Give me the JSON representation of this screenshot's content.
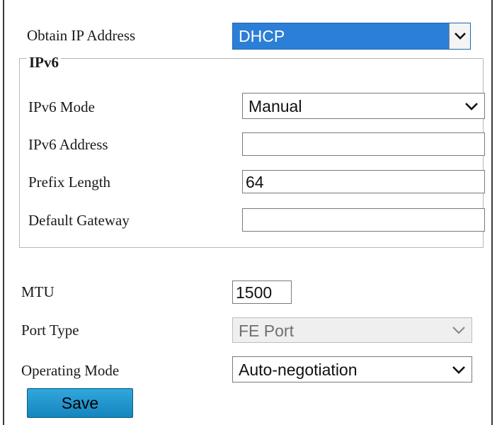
{
  "obtain_ip": {
    "label": "Obtain IP Address",
    "value": "DHCP"
  },
  "ipv6": {
    "legend": "IPv6",
    "mode": {
      "label": "IPv6 Mode",
      "value": "Manual"
    },
    "address": {
      "label": "IPv6 Address",
      "value": ""
    },
    "prefix_length": {
      "label": "Prefix Length",
      "value": "64"
    },
    "default_gateway": {
      "label": "Default Gateway",
      "value": ""
    }
  },
  "mtu": {
    "label": "MTU",
    "value": "1500"
  },
  "port_type": {
    "label": "Port Type",
    "value": "FE Port",
    "disabled": true
  },
  "operating_mode": {
    "label": "Operating Mode",
    "value": "Auto-negotiation"
  },
  "save_label": "Save",
  "icons": {
    "dropdown": "chevron-down-icon"
  },
  "colors": {
    "dhcp_highlight": "#2b7fd6",
    "save_button": "#1f95cc"
  }
}
